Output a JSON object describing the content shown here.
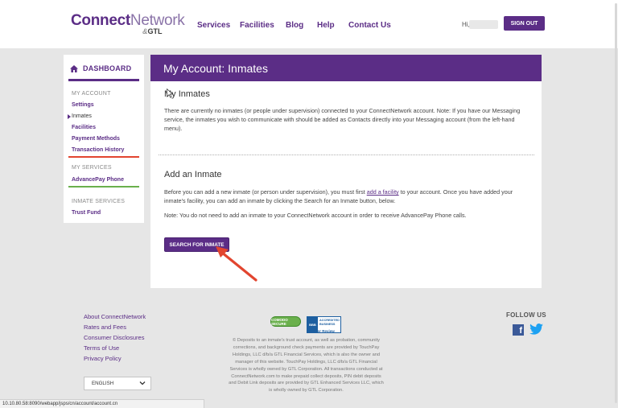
{
  "header": {
    "logo_connect": "Connect",
    "logo_network": "Network",
    "logo_by": "&",
    "logo_gtl": "GTL",
    "nav": [
      "Services",
      "Facilities",
      "Blog",
      "Help",
      "Contact Us"
    ],
    "greeting": "Hi,",
    "signout_label": "SIGN OUT"
  },
  "sidebar": {
    "dashboard_label": "DASHBOARD",
    "my_account_heading": "MY ACCOUNT",
    "my_account_items": [
      "Settings",
      "Inmates",
      "Facilities",
      "Payment Methods",
      "Transaction History"
    ],
    "active_item": "Inmates",
    "my_services_heading": "MY SERVICES",
    "my_services_items": [
      "AdvancePay Phone"
    ],
    "inmate_services_heading": "INMATE SERVICES",
    "inmate_services_items": [
      "Trust Fund"
    ]
  },
  "main": {
    "title": "My Account: Inmates",
    "my_inmates_heading": "My Inmates",
    "my_inmates_text": "There are currently no inmates (or people under supervision) connected to your ConnectNetwork account. Note: If you have our Messaging service, the inmates you wish to communicate with should be added as Contacts directly into your Messaging account (from the left-hand menu).",
    "add_heading": "Add an Inmate",
    "add_text_before": "Before you can add a new inmate (or person under supervision), you must first ",
    "add_link": "add a facility",
    "add_text_after": " to your account. Once you have added your inmate's facility, you can add an inmate by clicking the Search for an Inmate button, below.",
    "note_text": "Note: You do not need to add an inmate to your ConnectNetwork account in order to receive AdvancePay Phone calls.",
    "search_button": "SEARCH FOR INMATE"
  },
  "footer": {
    "links": [
      "About ConnectNetwork",
      "Rates and Fees",
      "Consumer Disclosures",
      "Terms of Use",
      "Privacy Policy"
    ],
    "language": "ENGLISH",
    "secure_badge": "COMODO SECURE",
    "bbb_left": "BBB",
    "bbb_right": "ACCREDITED BUSINESS",
    "bbb_click": "Click for Review",
    "legal": "© Deposits to an inmate's trust account, as well as probation, community corrections, and background check payments are provided by TouchPay Holdings, LLC d/b/a GTL Financial Services, which is also the owner and manager of this website. TouchPay Holdings, LLC d/b/a GTL Financial Services is wholly owned by GTL Corporation. All transactions conducted at ConnectNetwork.com to make prepaid collect deposits, PIN debit deposits and Debit Link deposits are provided by GTL Enhanced Services LLC, which is wholly owned by GTL Corporation.",
    "follow_us": "FOLLOW US",
    "facebook_icon": "facebook-icon",
    "twitter_icon": "twitter-icon"
  },
  "status_bar": "10.10.80.58:8090/webapp/jsps/cn/account/account.cn",
  "colors": {
    "brand_purple": "#5b2d86",
    "rule_purple": "#5b2d86",
    "rule_red": "#e2452f",
    "rule_green": "#6ab04c",
    "annotation_arrow": "#e2452f",
    "background": "#e6e6e6"
  }
}
